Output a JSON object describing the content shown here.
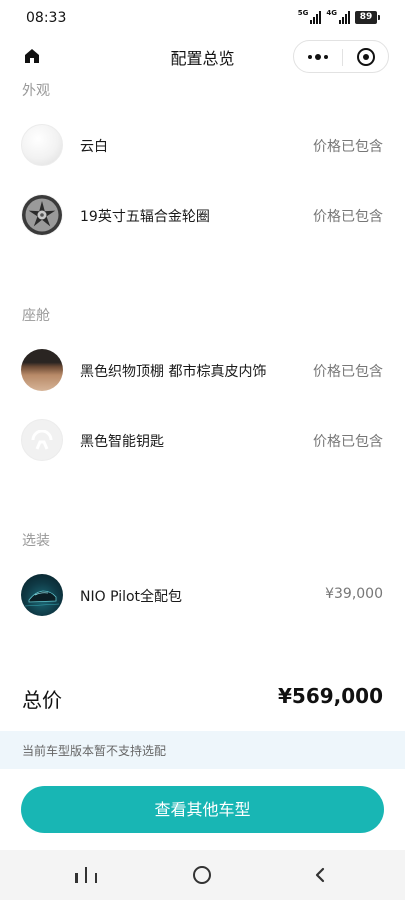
{
  "status_bar": {
    "time": "08:33",
    "network_1": "5G",
    "network_2": "4G",
    "battery": "89"
  },
  "nav": {
    "title": "配置总览",
    "home_icon": "home-icon",
    "more_icon": "more-icon",
    "close_icon": "close-target-icon"
  },
  "sections": {
    "exterior": {
      "title": "外观",
      "items": [
        {
          "label": "云白",
          "value": "价格已包含",
          "thumb": "white-paint-swatch"
        },
        {
          "label": "19英寸五辐合金轮圈",
          "value": "价格已包含",
          "thumb": "wheel-image"
        }
      ]
    },
    "cabin": {
      "title": "座舱",
      "items": [
        {
          "label": "黑色织物顶棚 都市棕真皮内饰",
          "value": "价格已包含",
          "thumb": "interior-swatch"
        },
        {
          "label": "黑色智能钥匙",
          "value": "价格已包含",
          "thumb": "nio-logo-key"
        }
      ]
    },
    "options": {
      "title": "选装",
      "items": [
        {
          "label": "NIO Pilot全配包",
          "value": "¥39,000",
          "thumb": "pilot-car-image"
        }
      ]
    }
  },
  "total": {
    "label": "总价",
    "value": "¥569,000"
  },
  "notice": "当前车型版本暂不支持选配",
  "cta_label": "查看其他车型",
  "colors": {
    "accent": "#18b6b4",
    "notice_bg": "#eef6fb",
    "section_title": "#999999",
    "secondary_text": "#777777"
  },
  "system_nav": {
    "recent_icon": "recent-apps-icon",
    "home_icon": "system-home-icon",
    "back_icon": "back-icon"
  }
}
